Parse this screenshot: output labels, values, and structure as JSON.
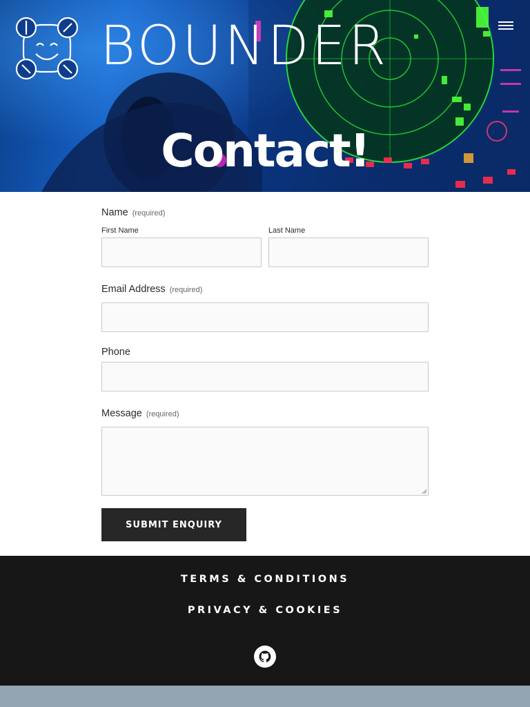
{
  "brand": {
    "name": "BOUNDER",
    "logo_icon": "bounder-smiley-drone-icon"
  },
  "nav": {
    "menu_icon": "hamburger-menu-icon"
  },
  "hero": {
    "title": "Contact!"
  },
  "form": {
    "name": {
      "label": "Name",
      "required": "(required)",
      "first_label": "First Name",
      "last_label": "Last Name",
      "first_value": "",
      "last_value": ""
    },
    "email": {
      "label": "Email Address",
      "required": "(required)",
      "value": ""
    },
    "phone": {
      "label": "Phone",
      "value": ""
    },
    "message": {
      "label": "Message",
      "required": "(required)",
      "value": ""
    },
    "submit_label": "SUBMIT ENQUIRY"
  },
  "footer": {
    "terms": "TERMS & CONDITIONS",
    "privacy": "PRIVACY & COOKIES",
    "github_icon": "github-icon"
  },
  "colors": {
    "footer_bg": "#171717",
    "button_bg": "#272727",
    "page_band": "#93a4b3"
  }
}
